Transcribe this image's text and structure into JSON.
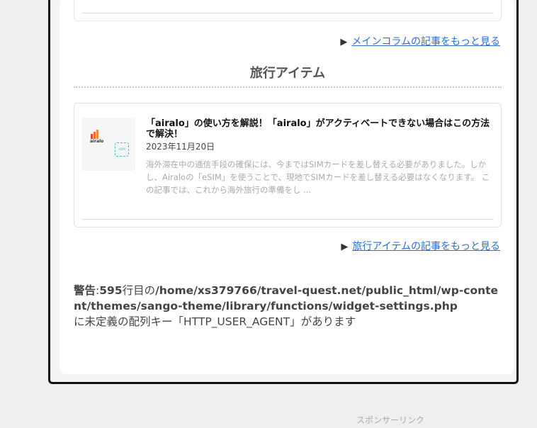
{
  "main_column": {
    "more_label": "メインコラムの記事をもっと見る"
  },
  "travel_items": {
    "title": "旅行アイテム",
    "post": {
      "title": "「airalo」の使い方を解説！「airalo」がアクティベートできない場合はこの方法で解決！",
      "date": "2023年11月20日",
      "excerpt": "海外滞在中の通信手段の確保には、今まではSIMカードを差し替える必要がありました。しかし、Airaloの「eSIM」を使うことで、現地でSIMカードを差し替える必要はなくなります。 この記事では、これから海外旅行の準備をし ...",
      "thumb_logo": "airalo",
      "thumb_badge": "eSIM"
    },
    "more_label": "旅行アイテムの記事をもっと見る"
  },
  "warning": {
    "label": "警告",
    "line": "595",
    "line_suffix": "行目の",
    "path": "/home/xs379766/travel-quest.net/public_html/wp-content/themes/sango-theme/library/functions/widget-settings.php",
    "message": "に未定義の配列キー「HTTP_USER_AGENT」があります"
  },
  "footer": {
    "sponsor_label": "スポンサーリンク"
  },
  "icons": {
    "arrow": "play-triangle-icon"
  },
  "colors": {
    "link": "#2b6ed6",
    "frame_border": "#111111"
  }
}
